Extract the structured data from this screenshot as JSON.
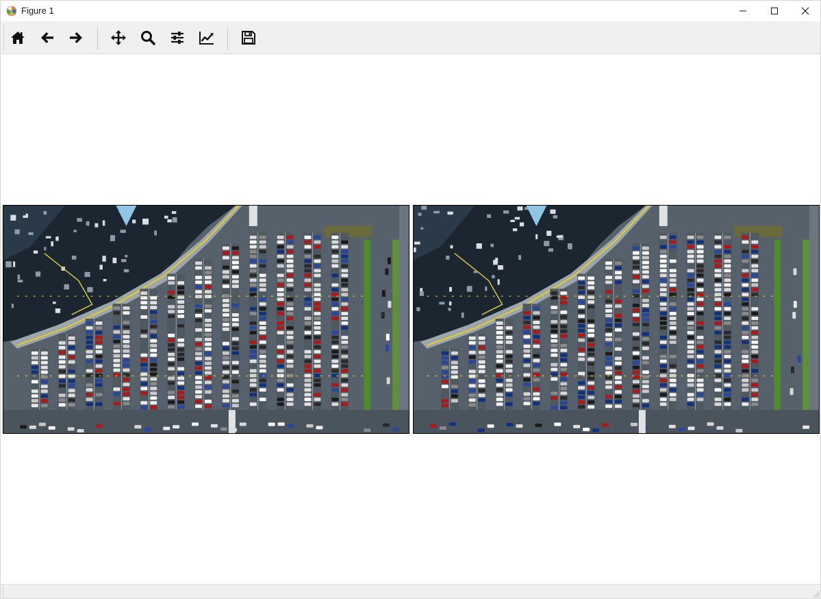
{
  "window": {
    "title": "Figure 1",
    "app_icon": "matplotlib-icon",
    "controls": [
      {
        "name": "minimize-button",
        "icon": "minimize-icon"
      },
      {
        "name": "maximize-button",
        "icon": "maximize-icon"
      },
      {
        "name": "close-button",
        "icon": "close-icon"
      }
    ]
  },
  "toolbar": {
    "buttons": [
      {
        "name": "home-button",
        "icon": "home-icon"
      },
      {
        "name": "back-button",
        "icon": "arrow-left-icon"
      },
      {
        "name": "forward-button",
        "icon": "arrow-right-icon"
      },
      {
        "name": "pan-button",
        "icon": "move-icon"
      },
      {
        "name": "zoom-button",
        "icon": "magnifier-icon"
      },
      {
        "name": "configure-subplots-button",
        "icon": "sliders-icon"
      },
      {
        "name": "edit-axes-button",
        "icon": "line-chart-icon"
      },
      {
        "name": "save-button",
        "icon": "floppy-disk-icon"
      }
    ]
  },
  "figure": {
    "subplots": [
      {
        "name": "left-image-axes",
        "content": "aerial-parking-lot-image"
      },
      {
        "name": "right-image-axes",
        "content": "aerial-parking-lot-image"
      }
    ]
  },
  "statusbar": {
    "message": ""
  },
  "colors": {
    "toolbar_bg": "#f0f0f0",
    "window_bg": "#ffffff",
    "icon_color": "#111111"
  }
}
